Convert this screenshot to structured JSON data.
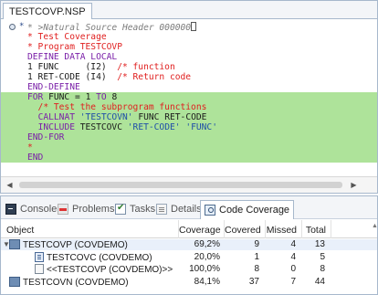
{
  "editor": {
    "tab_title": "TESTCOVP.NSP",
    "lines": [
      {
        "text": "* >Natural Source Header 000000",
        "style": "header",
        "hl": false,
        "marker": "*",
        "fold": true,
        "caret": true
      },
      {
        "text": "* Test Coverage",
        "style": "comment",
        "hl": false
      },
      {
        "text": "* Program TESTCOVP",
        "style": "comment",
        "hl": false
      },
      {
        "text": "DEFINE DATA LOCAL",
        "style": "keyword",
        "hl": false
      },
      {
        "text": "1 FUNC     (I2)  /* function",
        "style": "mixed_def1",
        "hl": false
      },
      {
        "text": "1 RET-CODE (I4)  /* Return code",
        "style": "mixed_def2",
        "hl": false
      },
      {
        "text": "END-DEFINE",
        "style": "keyword",
        "hl": false
      },
      {
        "text": "FOR FUNC = 1 TO 8",
        "style": "mixed_for",
        "hl": true
      },
      {
        "text": "  /* Test the subprogram functions",
        "style": "comment",
        "hl": true
      },
      {
        "text": "  CALLNAT 'TESTCOVN' FUNC RET-CODE",
        "style": "mixed_callnat",
        "hl": true
      },
      {
        "text": "  INCLUDE TESTCOVC 'RET-CODE' 'FUNC'",
        "style": "mixed_include",
        "hl": true
      },
      {
        "text": "END-FOR",
        "style": "keyword",
        "hl": true
      },
      {
        "text": "*",
        "style": "comment",
        "hl": true
      },
      {
        "text": "END",
        "style": "keyword",
        "hl": true
      }
    ]
  },
  "views": {
    "tabs": [
      {
        "label": "Console",
        "icon": "console-icon",
        "active": false
      },
      {
        "label": "Problems",
        "icon": "problems-icon",
        "active": false
      },
      {
        "label": "Tasks",
        "icon": "tasks-icon",
        "active": false
      },
      {
        "label": "Details",
        "icon": "details-icon",
        "active": false
      },
      {
        "label": "Code Coverage",
        "icon": "coverage-icon",
        "active": true
      }
    ],
    "columns": {
      "object": "Object",
      "coverage": "Coverage",
      "covered": "Covered",
      "missed": "Missed",
      "total": "Total"
    },
    "rows": [
      {
        "object": "TESTCOVP (COVDEMO)",
        "coverage": "69,2%",
        "covered": "9",
        "missed": "4",
        "total": "13",
        "level": 0,
        "expanded": true,
        "icon": "package-icon",
        "selected": true
      },
      {
        "object": "TESTCOVC (COVDEMO)",
        "coverage": "20,0%",
        "covered": "1",
        "missed": "4",
        "total": "5",
        "level": 1,
        "icon": "program-icon"
      },
      {
        "object": "<<TESTCOVP (COVDEMO)>>",
        "coverage": "100,0%",
        "covered": "8",
        "missed": "0",
        "total": "8",
        "level": 1,
        "icon": "object-icon"
      },
      {
        "object": "TESTCOVN (COVDEMO)",
        "coverage": "84,1%",
        "covered": "37",
        "missed": "7",
        "total": "44",
        "level": 0,
        "icon": "package-icon"
      }
    ]
  },
  "colors": {
    "highlight": "#aee39a",
    "comment": "#e02020",
    "keyword": "#7a1fa8",
    "string": "#1f4fa8"
  }
}
